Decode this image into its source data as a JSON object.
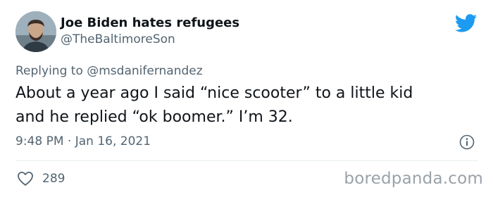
{
  "tweet": {
    "display_name": "Joe Biden hates refugees",
    "handle": "@TheBaltimoreSon",
    "replying_prefix": "Replying to",
    "replying_mention": "@msdanifernandez",
    "text_line1": "About a year ago I said “nice scooter” to a little kid",
    "text_line2": "and he replied “ok boomer.” I’m 32.",
    "timestamp": "9:48 PM · Jan 16, 2021",
    "like_count": "289"
  },
  "watermark": "boredpanda.com",
  "colors": {
    "twitter_blue": "#1d9bf0",
    "secondary_text": "#536471",
    "primary_text": "#0f1419",
    "watermark": "#9aa2a8"
  },
  "icons": {
    "brand": "twitter-bird-icon",
    "info": "info-icon",
    "like": "heart-icon"
  }
}
